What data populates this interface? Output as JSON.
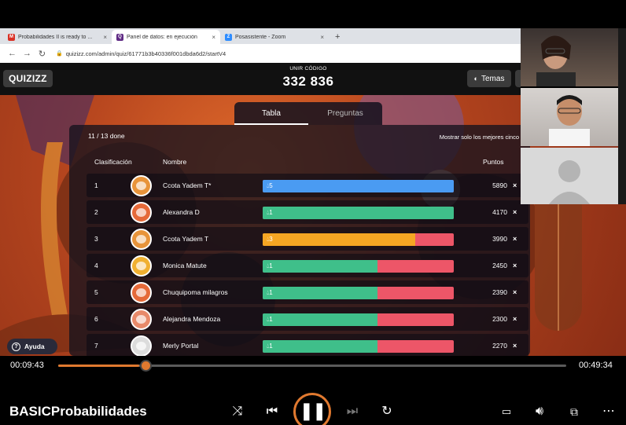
{
  "browser": {
    "tabs": [
      {
        "title": "Probabilidades II is ready to ...",
        "icon": "gmail-icon",
        "color": "#d93025",
        "glyph": "M"
      },
      {
        "title": "Panel de datos: en ejecución",
        "icon": "quizizz-icon",
        "color": "#5f2a84",
        "glyph": "Q"
      },
      {
        "title": "Posasistente - Zoom",
        "icon": "zoom-icon",
        "color": "#2d8cff",
        "glyph": "Z"
      }
    ],
    "new_tab": "+",
    "close": "×",
    "url": "quizizz.com/admin/quiz/61771b3b40336f001dbda6d2/startV4"
  },
  "quizizz": {
    "logo": "QUIZIZZ",
    "join_label": "UNIR CÓDIGO",
    "join_code": "332 836",
    "themes_label": "Temas"
  },
  "leaderboard": {
    "tabs": [
      "Tabla",
      "Preguntas"
    ],
    "progress": "11 / 13 done",
    "show_best": "Mostrar solo los mejores cinco",
    "columns": {
      "rank": "Clasificación",
      "name": "Nombre",
      "points": "Puntos"
    },
    "remove": "×",
    "rows": [
      {
        "rank": "1",
        "name": "Ccota Yadem T*",
        "streak": "5",
        "points": "5890",
        "bar_color": "#4a9bf2",
        "correct_ratio": 1.0,
        "avatar_color": "#e8943a"
      },
      {
        "rank": "2",
        "name": "Alexandra D",
        "streak": "1",
        "points": "4170",
        "bar_color": "#3fbf8a",
        "correct_ratio": 1.0,
        "avatar_color": "#e56a3a"
      },
      {
        "rank": "3",
        "name": "Ccota Yadem T",
        "streak": "3",
        "points": "3990",
        "bar_color": "#f5a623",
        "correct_ratio": 0.8,
        "avatar_color": "#e8943a"
      },
      {
        "rank": "4",
        "name": "Monica Matute",
        "streak": "1",
        "points": "2450",
        "bar_color": "#3fbf8a",
        "correct_ratio": 0.6,
        "avatar_color": "#f0b030"
      },
      {
        "rank": "5",
        "name": "Chuquipoma milagros",
        "streak": "1",
        "points": "2390",
        "bar_color": "#3fbf8a",
        "correct_ratio": 0.6,
        "avatar_color": "#e56a3a"
      },
      {
        "rank": "6",
        "name": "Alejandra Mendoza",
        "streak": "1",
        "points": "2300",
        "bar_color": "#3fbf8a",
        "correct_ratio": 0.6,
        "avatar_color": "#e88a6a"
      },
      {
        "rank": "7",
        "name": "Merly Portal",
        "streak": "1",
        "points": "2270",
        "bar_color": "#3fbf8a",
        "correct_ratio": 0.6,
        "avatar_color": "#dcdcdc"
      }
    ],
    "help_label": "Ayuda"
  },
  "player": {
    "elapsed": "00:09:43",
    "total": "00:49:34",
    "progress": 0.16,
    "title": "BASICProbabilidades",
    "accent": "#e0792f"
  }
}
